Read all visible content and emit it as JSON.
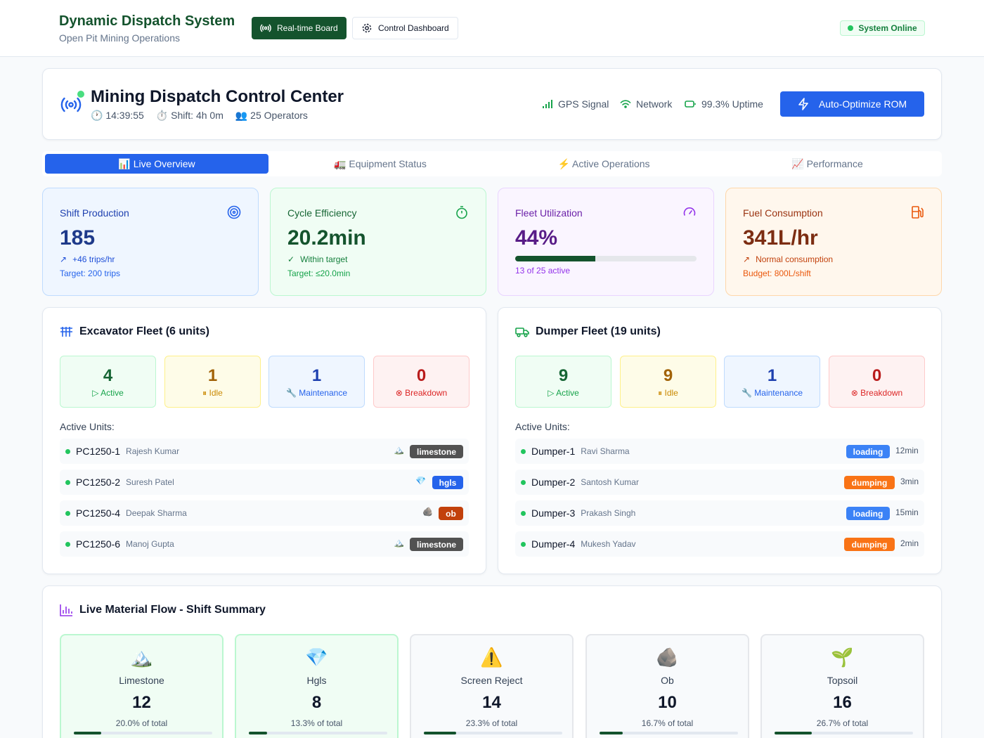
{
  "app": {
    "title": "Dynamic Dispatch System",
    "subtitle": "Open Pit Mining Operations"
  },
  "nav": {
    "realtime": "Real-time Board",
    "control": "Control Dashboard",
    "status": "System Online"
  },
  "header": {
    "title": "Mining Dispatch Control Center",
    "time": "🕐 14:39:55",
    "shift": "⏱️ Shift: 4h 0m",
    "operators": "👥 25 Operators",
    "gps": "GPS Signal",
    "network": "Network",
    "uptime": "99.3% Uptime",
    "optimize": "Auto-Optimize ROM"
  },
  "tabs": [
    "📊 Live Overview",
    "🚛 Equipment Status",
    "⚡ Active Operations",
    "📈 Performance"
  ],
  "kpis": [
    {
      "label": "Shift Production",
      "value": "185",
      "line1": "+46 trips/hr",
      "line2": "Target: 200 trips",
      "icon": "target-icon"
    },
    {
      "label": "Cycle Efficiency",
      "value": "20.2min",
      "line1": "Within target",
      "line2": "Target: ≤20.0min",
      "icon": "timer-icon"
    },
    {
      "label": "Fleet Utilization",
      "value": "44%",
      "line1": "13 of 25 active",
      "progress": 0.44,
      "icon": "gauge-icon"
    },
    {
      "label": "Fuel Consumption",
      "value": "341L/hr",
      "line1": "Normal consumption",
      "line2": "Budget: 800L/shift",
      "icon": "fuel-icon"
    }
  ],
  "excavator": {
    "title": "Excavator Fleet (6 units)",
    "stats": [
      {
        "n": "4",
        "t": "▷ Active"
      },
      {
        "n": "1",
        "t": "⏸ Idle"
      },
      {
        "n": "1",
        "t": "🔧 Maintenance"
      },
      {
        "n": "0",
        "t": "⊗ Breakdown"
      }
    ],
    "active_label": "Active Units:",
    "units": [
      {
        "id": "PC1250-1",
        "op": "Rajesh Kumar",
        "emoji": "🏔️",
        "mat": "limestone"
      },
      {
        "id": "PC1250-2",
        "op": "Suresh Patel",
        "emoji": "💎",
        "mat": "hgls"
      },
      {
        "id": "PC1250-4",
        "op": "Deepak Sharma",
        "emoji": "🪨",
        "mat": "ob"
      },
      {
        "id": "PC1250-6",
        "op": "Manoj Gupta",
        "emoji": "🏔️",
        "mat": "limestone"
      }
    ]
  },
  "dumper": {
    "title": "Dumper Fleet (19 units)",
    "stats": [
      {
        "n": "9",
        "t": "▷ Active"
      },
      {
        "n": "9",
        "t": "⏸ Idle"
      },
      {
        "n": "1",
        "t": "🔧 Maintenance"
      },
      {
        "n": "0",
        "t": "⊗ Breakdown"
      }
    ],
    "active_label": "Active Units:",
    "units": [
      {
        "id": "Dumper-1",
        "op": "Ravi Sharma",
        "state": "loading",
        "mins": "12min"
      },
      {
        "id": "Dumper-2",
        "op": "Santosh Kumar",
        "state": "dumping",
        "mins": "3min"
      },
      {
        "id": "Dumper-3",
        "op": "Prakash Singh",
        "state": "loading",
        "mins": "15min"
      },
      {
        "id": "Dumper-4",
        "op": "Mukesh Yadav",
        "state": "dumping",
        "mins": "2min"
      }
    ]
  },
  "flow": {
    "title": "Live Material Flow - Shift Summary",
    "items": [
      {
        "emoji": "🏔️",
        "name": "Limestone",
        "count": "12",
        "pct": "20.0% of total",
        "frac": 0.2
      },
      {
        "emoji": "💎",
        "name": "Hgls",
        "count": "8",
        "pct": "13.3% of total",
        "frac": 0.133
      },
      {
        "emoji": "⚠️",
        "name": "Screen Reject",
        "count": "14",
        "pct": "23.3% of total",
        "frac": 0.233
      },
      {
        "emoji": "🪨",
        "name": "Ob",
        "count": "10",
        "pct": "16.7% of total",
        "frac": 0.167
      },
      {
        "emoji": "🌱",
        "name": "Topsoil",
        "count": "16",
        "pct": "26.7% of total",
        "frac": 0.267
      }
    ]
  },
  "colors": {
    "brand": "#14532d",
    "accent": "#2563eb",
    "limestone": "#525252",
    "hgls": "#2563eb",
    "ob": "#c2410c",
    "loading": "#3b82f6",
    "dumping": "#f97316"
  }
}
